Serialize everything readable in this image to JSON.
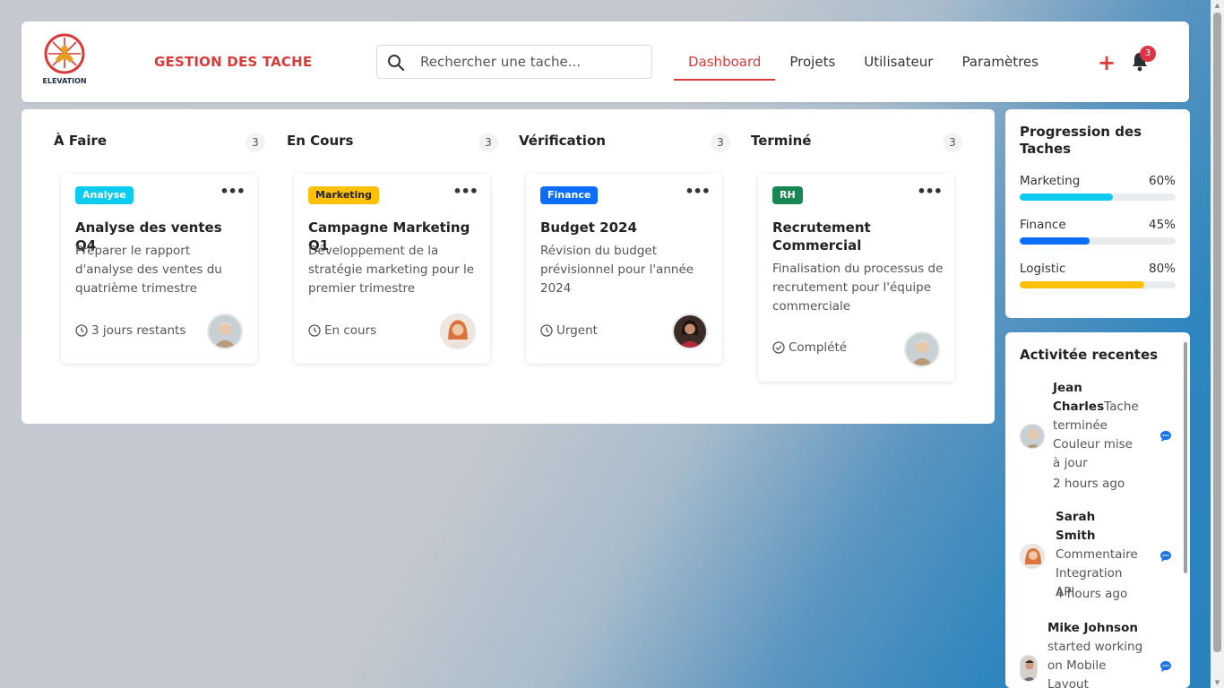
{
  "header": {
    "logo_text": "ELEVATION",
    "brand": "GESTION DES TACHE",
    "search_placeholder": "Rechercher une tache...",
    "nav": [
      "Dashboard",
      "Projets",
      "Utilisateur",
      "Paramètres"
    ],
    "active_tab": "Dashboard",
    "add_label": "+",
    "notification_count": "3"
  },
  "board": {
    "columns": [
      {
        "title": "À Faire",
        "count": "3",
        "card": {
          "tag": "Analyse",
          "tag_color": "#0dcaf0",
          "title": "Analyse des ventes Q4",
          "description": "Préparer le rapport d'analyse des ventes du quatrième trimestre",
          "status_icon": "clock-icon",
          "status": "3 jours restants"
        }
      },
      {
        "title": "En Cours",
        "count": "3",
        "card": {
          "tag": "Marketing",
          "tag_color": "#ffc107",
          "title": "Campagne Marketing Q1",
          "description": "Développement de la stratégie marketing pour le premier trimestre",
          "status_icon": "clock-icon",
          "status": "En cours"
        }
      },
      {
        "title": "Vérification",
        "count": "3",
        "card": {
          "tag": "Finance",
          "tag_color": "#0d6efd",
          "title": "Budget 2024",
          "description": "Révision du budget prévisionnel pour l'année 2024",
          "status_icon": "clock-icon",
          "status": "Urgent"
        }
      },
      {
        "title": "Terminé",
        "count": "3",
        "card": {
          "tag": "RH",
          "tag_color": "#198754",
          "title": "Recrutement Commercial",
          "description": "Finalisation du processus de recrutement pour l'équipe commerciale",
          "status_icon": "check-circle-icon",
          "status": "Complété"
        }
      }
    ]
  },
  "progress": {
    "title": "Progression des Taches",
    "items": [
      {
        "label": "Marketing",
        "value": "60%",
        "fraction": 0.6,
        "color": "#0dcaf0"
      },
      {
        "label": "Finance",
        "value": "45%",
        "fraction": 0.45,
        "color": "#0d6efd"
      },
      {
        "label": "Logistic",
        "value": "80%",
        "fraction": 0.8,
        "color": "#ffc107"
      }
    ]
  },
  "activity": {
    "title": "Activitée recentes",
    "items": [
      {
        "name": "Jean Charles",
        "action": "Tache terminée",
        "detail": "Couleur mise à jour",
        "time": "2 hours ago"
      },
      {
        "name": "Sarah Smith",
        "action": "Commentaire",
        "detail": "Integration API",
        "time": "4 hours ago"
      },
      {
        "name": "Mike Johnson",
        "action": "started working",
        "detail": "on Mobile Layout",
        "time": ""
      }
    ]
  }
}
